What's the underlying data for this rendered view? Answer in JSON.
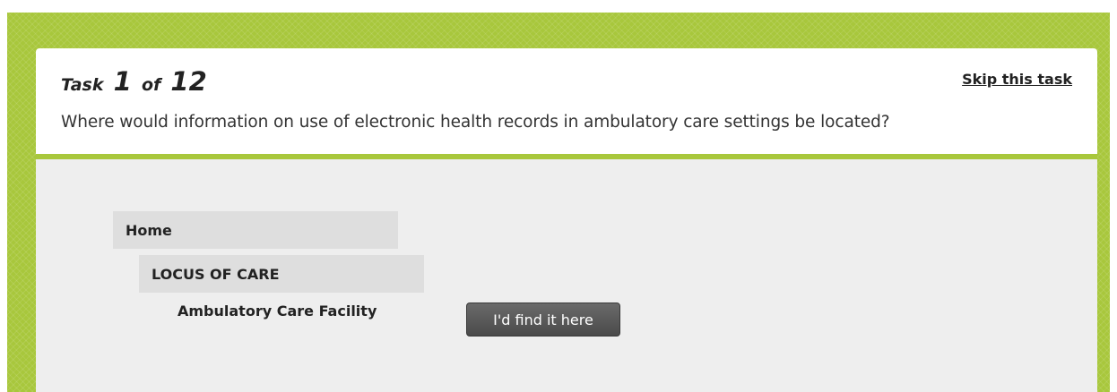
{
  "task": {
    "task_word": "Task",
    "current": "1",
    "of_word": "of",
    "total": "12",
    "skip_label": "Skip this task",
    "question": "Where would information on use of electronic health records in ambulatory care settings be located?"
  },
  "tree": {
    "home": "Home",
    "level1": "LOCUS OF CARE",
    "level2": "Ambulatory Care Facility",
    "select_button": "I'd find it here"
  },
  "colors": {
    "frame_green": "#a8c73c",
    "tree_background": "#eeeeee",
    "node_background": "#dedede",
    "button_background": "#555555"
  }
}
